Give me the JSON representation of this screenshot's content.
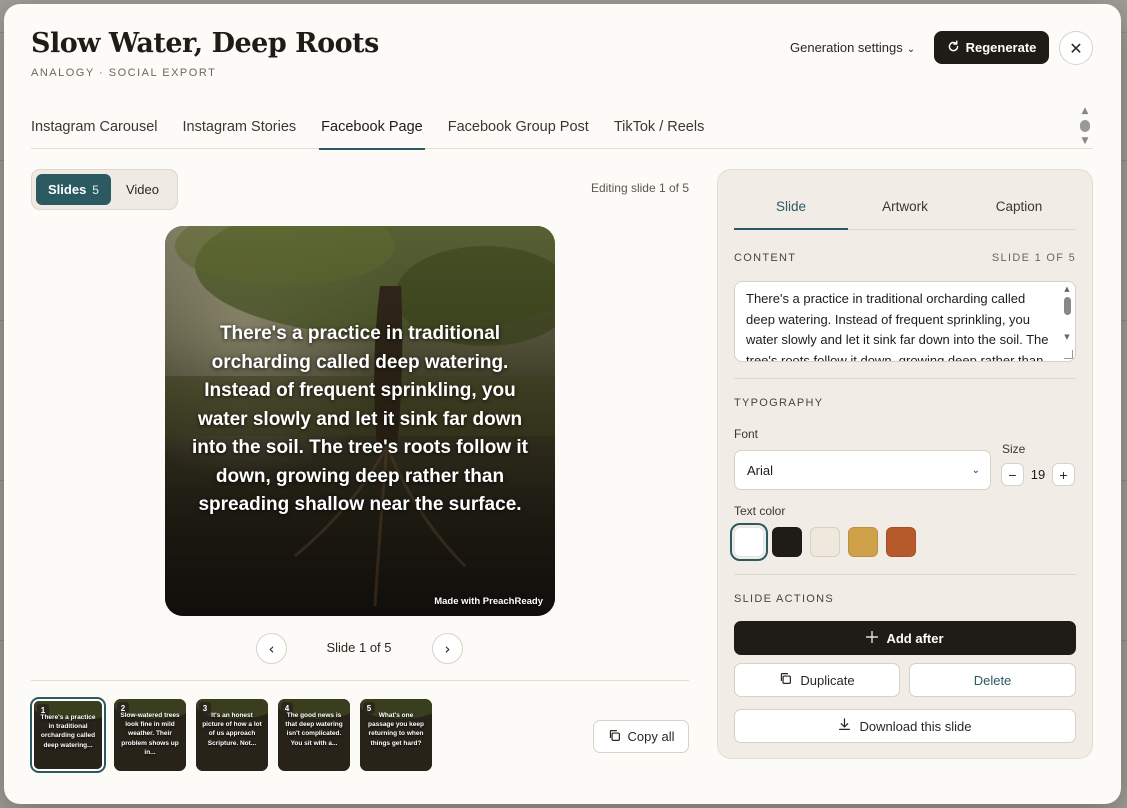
{
  "header": {
    "title": "Slow Water, Deep Roots",
    "subtitle": "ANALOGY · SOCIAL EXPORT",
    "generation_settings": "Generation settings",
    "regenerate": "Regenerate"
  },
  "tabs": [
    {
      "label": "Instagram Carousel"
    },
    {
      "label": "Instagram Stories"
    },
    {
      "label": "Facebook Page",
      "active": true
    },
    {
      "label": "Facebook Group Post"
    },
    {
      "label": "TikTok / Reels"
    }
  ],
  "mode": {
    "slides_label": "Slides",
    "slides_count": "5",
    "video_label": "Video"
  },
  "editing_status": "Editing slide 1 of 5",
  "preview": {
    "text": "There's a practice in traditional orcharding called deep watering. Instead of frequent sprinkling, you water slowly and let it sink far down into the soil. The tree's roots follow it down, growing deep rather than spreading shallow near the surface.",
    "watermark": "Made with PreachReady"
  },
  "pager": {
    "prev": "‹",
    "next": "›",
    "indicator": "Slide 1 of 5"
  },
  "thumbnails": [
    {
      "num": "1",
      "text": "There's a practice in traditional orcharding called deep watering..."
    },
    {
      "num": "2",
      "text": "Slow-watered trees look fine in mild weather. Their problem shows up in..."
    },
    {
      "num": "3",
      "text": "It's an honest picture of how a lot of us approach Scripture. Not..."
    },
    {
      "num": "4",
      "text": "The good news is that deep watering isn't complicated. You sit with a..."
    },
    {
      "num": "5",
      "text": "What's one passage you keep returning to when things get hard?"
    }
  ],
  "copy_all": "Copy all",
  "panel": {
    "tabs": [
      "Slide",
      "Artwork",
      "Caption"
    ],
    "content_label": "CONTENT",
    "slide_position": "SLIDE 1 OF 5",
    "content_value": "There's a practice in traditional orcharding called deep watering. Instead of frequent sprinkling, you water slowly and let it sink far down into the soil. The tree's roots follow it down, growing deep rather than spreading shallow near the surface.",
    "typography_label": "TYPOGRAPHY",
    "font_label": "Font",
    "font_value": "Arial",
    "size_label": "Size",
    "size_value": "19",
    "size_minus": "−",
    "size_plus": "+",
    "text_color_label": "Text color",
    "swatches": [
      "#ffffff",
      "#1f1c18",
      "#efe8dc",
      "#cfa24a",
      "#b75a2b"
    ],
    "selected_swatch": "#ffffff",
    "slide_actions_label": "SLIDE ACTIONS",
    "add_after": "Add after",
    "duplicate": "Duplicate",
    "delete": "Delete",
    "download": "Download this slide"
  },
  "colors": {
    "accent": "#2b5a62",
    "dark": "#1f1c18"
  }
}
